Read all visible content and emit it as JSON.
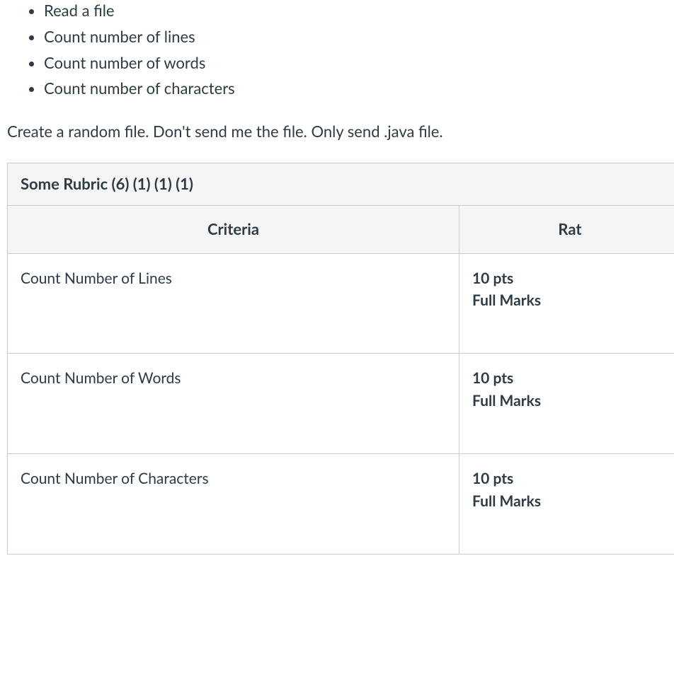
{
  "bullets": [
    "Read a file",
    "Count number of lines",
    "Count number of words",
    "Count number of characters"
  ],
  "instruction": "Create a random file.  Don't send me the file.  Only send .java file.",
  "rubric": {
    "title": "Some Rubric (6) (1) (1) (1)",
    "columns": {
      "criteria": "Criteria",
      "ratings": "Rat"
    },
    "rows": [
      {
        "criteria": "Count Number of Lines",
        "pts": "10 pts",
        "label": "Full Marks"
      },
      {
        "criteria": "Count Number of Words",
        "pts": "10 pts",
        "label": "Full Marks"
      },
      {
        "criteria": "Count Number of Characters",
        "pts": "10 pts",
        "label": "Full Marks"
      }
    ]
  }
}
